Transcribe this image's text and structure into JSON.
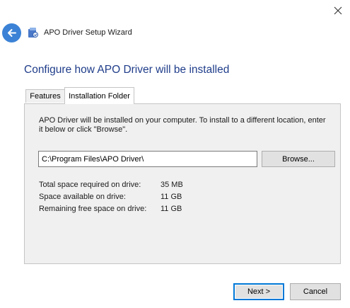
{
  "window": {
    "title": "APO Driver Setup Wizard",
    "close_icon": "close-icon",
    "back_icon": "back-arrow-icon",
    "app_icon": "setup-app-icon"
  },
  "page": {
    "heading": "Configure how APO Driver will be installed"
  },
  "tabs": [
    {
      "label": "Features",
      "selected": false
    },
    {
      "label": "Installation Folder",
      "selected": true
    }
  ],
  "installation_folder": {
    "description": "APO Driver will be installed on your computer. To install to a different location, enter it below or click \"Browse\".",
    "path_value": "C:\\Program Files\\APO Driver\\",
    "browse_label": "Browse...",
    "space": [
      {
        "label": "Total space required on drive:",
        "value": "35 MB"
      },
      {
        "label": "Space available on drive:",
        "value": "11 GB"
      },
      {
        "label": "Remaining free space on drive:",
        "value": "11 GB"
      }
    ]
  },
  "buttons": {
    "next_label": "Next >",
    "cancel_label": "Cancel"
  },
  "colors": {
    "accent": "#0078d7",
    "heading": "#1f3d8a",
    "back_button": "#3b82d6"
  }
}
